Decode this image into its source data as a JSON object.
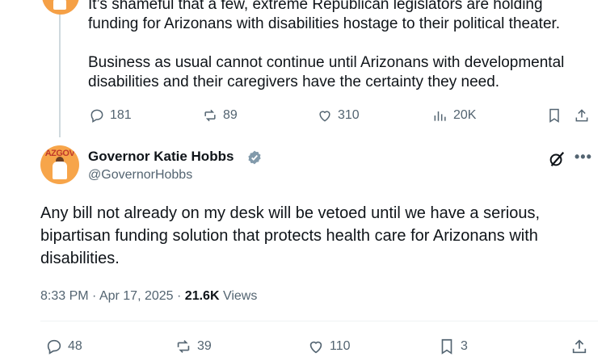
{
  "tweet1": {
    "text": "It’s shameful that a few, extreme Republican legislators are holding funding for Arizonans with disabilities hostage to their political theater.\n\nBusiness as usual cannot continue until Arizonans with developmental disabilities and their caregivers have the certainty they need.",
    "actions": {
      "replies": "181",
      "reposts": "89",
      "likes": "310",
      "views": "20K"
    }
  },
  "tweet2": {
    "author_name": "Governor Katie Hobbs",
    "handle": "@GovernorHobbs",
    "text": "Any bill not already on my desk will be vetoed until we have a serious, bipartisan funding solution that protects health care for Arizonans with disabilities.",
    "time": "8:33 PM",
    "date": "Apr 17, 2025",
    "views_count": "21.6K",
    "views_label": "Views",
    "actions": {
      "replies": "48",
      "reposts": "39",
      "likes": "110",
      "bookmarks": "3"
    }
  },
  "colors": {
    "text": "#0f1419",
    "muted": "#536471",
    "verified": "#829aab"
  },
  "icons": [
    "reply-icon",
    "repost-icon",
    "like-icon",
    "views-icon",
    "bookmark-icon",
    "share-icon",
    "verified-badge-icon",
    "grok-icon",
    "more-icon"
  ]
}
